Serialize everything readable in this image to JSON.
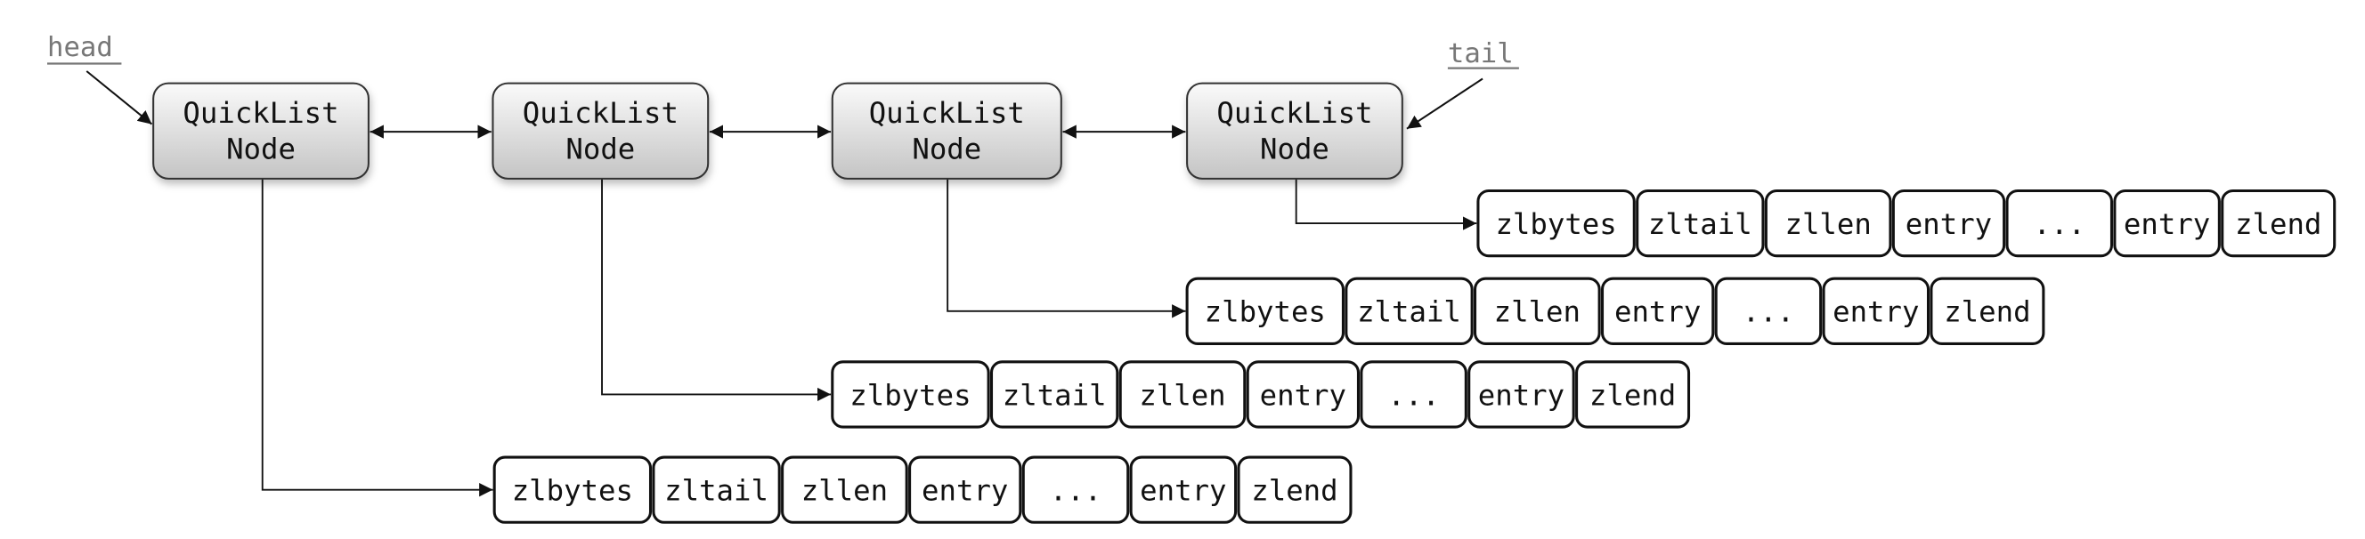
{
  "labels": {
    "head": "head",
    "tail": "tail"
  },
  "nodes": [
    {
      "line1": "QuickList",
      "line2": "Node"
    },
    {
      "line1": "QuickList",
      "line2": "Node"
    },
    {
      "line1": "QuickList",
      "line2": "Node"
    },
    {
      "line1": "QuickList",
      "line2": "Node"
    }
  ],
  "ziplist_fields": [
    "zlbytes",
    "zltail",
    "zllen",
    "entry",
    "...",
    "entry",
    "zlend"
  ],
  "colors": {
    "node_fill_top": "#fafafa",
    "node_fill_bottom": "#c8c8c8",
    "stroke": "#111111",
    "label": "#777777"
  }
}
